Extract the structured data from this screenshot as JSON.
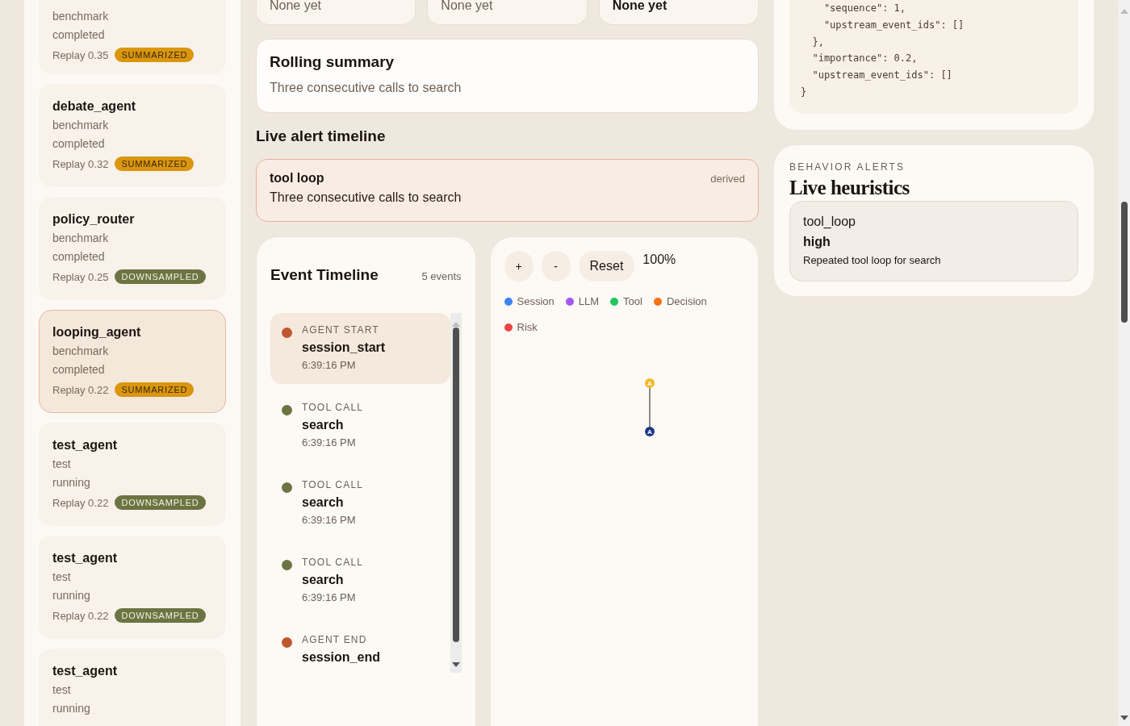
{
  "sessions": [
    {
      "kind": "benchmark",
      "status": "completed",
      "replay": "Replay 0.35",
      "badge": {
        "label": "SUMMARIZED",
        "color": "#d9960e"
      },
      "selected": false
    },
    {
      "name": "debate_agent",
      "kind": "benchmark",
      "status": "completed",
      "replay": "Replay 0.32",
      "badge": {
        "label": "SUMMARIZED",
        "color": "#d9960e"
      },
      "selected": false
    },
    {
      "name": "policy_router",
      "kind": "benchmark",
      "status": "completed",
      "replay": "Replay 0.25",
      "badge": {
        "label": "DOWNSAMPLED",
        "color": "#6b7442"
      },
      "selected": false
    },
    {
      "name": "looping_agent",
      "kind": "benchmark",
      "status": "completed",
      "replay": "Replay 0.22",
      "badge": {
        "label": "SUMMARIZED",
        "color": "#d9960e"
      },
      "selected": true
    },
    {
      "name": "test_agent",
      "kind": "test",
      "status": "running",
      "replay": "Replay 0.22",
      "badge": {
        "label": "DOWNSAMPLED",
        "color": "#6b7442"
      },
      "selected": false
    },
    {
      "name": "test_agent",
      "kind": "test",
      "status": "running",
      "replay": "Replay 0.22",
      "badge": {
        "label": "DOWNSAMPLED",
        "color": "#6b7442"
      },
      "selected": false
    },
    {
      "name": "test_agent",
      "kind": "test",
      "status": "running",
      "selected": false
    }
  ],
  "stat_cards": [
    {
      "value": "None yet",
      "highlighted": false
    },
    {
      "value": "None yet",
      "highlighted": false
    },
    {
      "value": "None yet",
      "highlighted": true
    }
  ],
  "rolling_summary": {
    "title": "Rolling summary",
    "text": "Three consecutive calls to search"
  },
  "alert_timeline": {
    "title": "Live alert timeline",
    "alerts": [
      {
        "title": "tool loop",
        "source": "derived",
        "text": "Three consecutive calls to search"
      }
    ]
  },
  "event_timeline": {
    "title": "Event Timeline",
    "count": "5 events",
    "events": [
      {
        "type": "AGENT START",
        "name": "session_start",
        "time": "6:39:16 PM",
        "kind": "agent",
        "selected": true
      },
      {
        "type": "TOOL CALL",
        "name": "search",
        "time": "6:39:16 PM",
        "kind": "tool",
        "selected": false
      },
      {
        "type": "TOOL CALL",
        "name": "search",
        "time": "6:39:16 PM",
        "kind": "tool",
        "selected": false
      },
      {
        "type": "TOOL CALL",
        "name": "search",
        "time": "6:39:16 PM",
        "kind": "tool",
        "selected": false
      },
      {
        "type": "AGENT END",
        "name": "session_end",
        "kind": "agent",
        "selected": false
      }
    ]
  },
  "graph": {
    "buttons": [
      "+",
      "-",
      "Reset"
    ],
    "zoom": "100%",
    "legend": [
      {
        "label": "Session",
        "color": "#3b82f6"
      },
      {
        "label": "LLM",
        "color": "#a855f7"
      },
      {
        "label": "Tool",
        "color": "#22c55e"
      },
      {
        "label": "Decision",
        "color": "#f97316"
      },
      {
        "label": "Risk",
        "color": "#ef4444"
      }
    ],
    "nodes": [
      {
        "label": "A",
        "color": "#f5b82e"
      },
      {
        "label": "A",
        "color": "#1e3a8a"
      }
    ]
  },
  "event_json": "    \"sequence\": 1,\n    \"upstream_event_ids\": []\n  },\n  \"importance\": 0.2,\n  \"upstream_event_ids\": []\n}",
  "behavior_alerts": {
    "eyebrow": "BEHAVIOR ALERTS",
    "title": "Live heuristics",
    "alerts": [
      {
        "type": "tool_loop",
        "severity": "high",
        "text": "Repeated tool loop for search"
      }
    ]
  }
}
